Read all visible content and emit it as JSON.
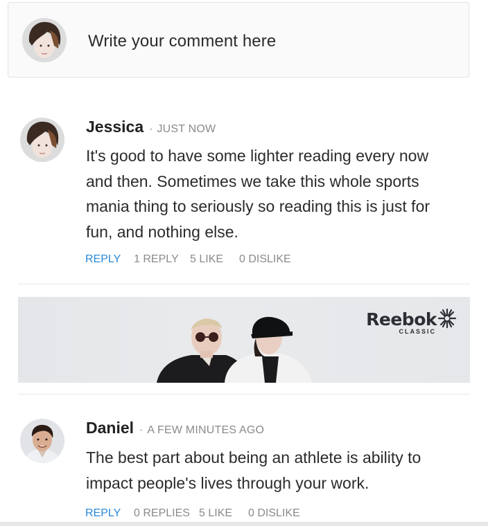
{
  "composer": {
    "placeholder": "Write your comment here"
  },
  "comments": [
    {
      "author": "Jessica",
      "time": "JUST NOW",
      "body_lines": [
        "It's good to have some lighter reading every now",
        "and then. Sometimes we take this whole sports",
        "mania thing to seriously so reading this is just for",
        "fun, and nothing else."
      ],
      "actions": {
        "reply": "REPLY",
        "replies": "1 REPLY",
        "likes": "5 LIKE",
        "dislikes": "0 DISLIKE"
      }
    },
    {
      "author": "Daniel",
      "time": "A FEW MINUTES AGO",
      "body_lines": [
        "The best part about being an athlete is ability to",
        "impact people's lives through your work."
      ],
      "actions": {
        "reply": "REPLY",
        "replies": "0 REPLIES",
        "likes": "5 LIKE",
        "dislikes": "0 DISLIKE"
      }
    }
  ],
  "ad": {
    "brand": "Reebok",
    "sub": "CLASSIC"
  },
  "colors": {
    "link": "#2a88d8",
    "meta": "#8a8a8a",
    "text": "#2b2b2b"
  }
}
